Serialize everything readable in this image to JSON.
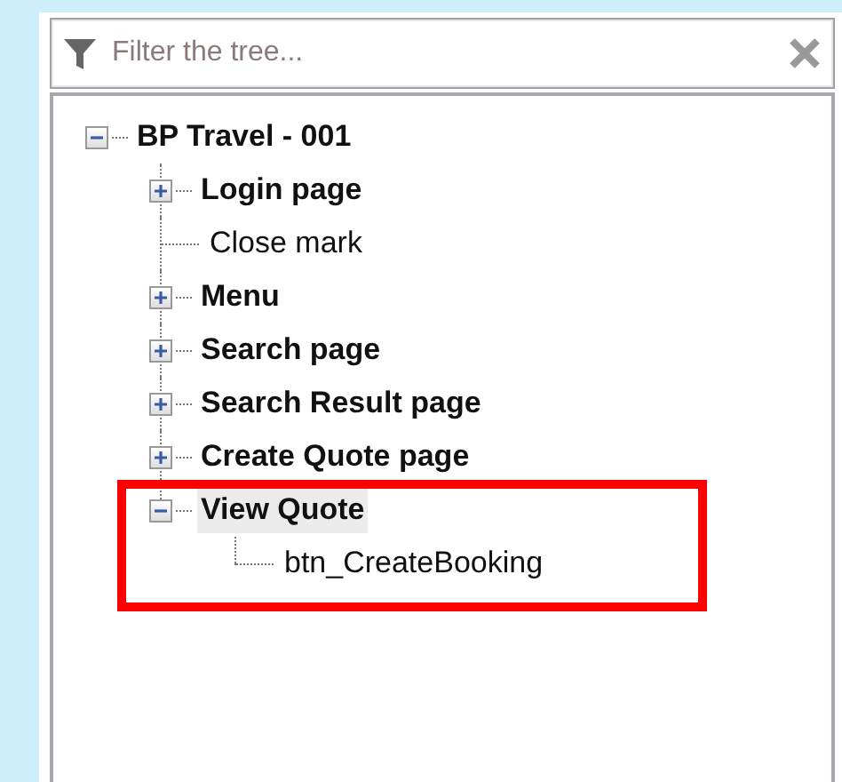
{
  "filter": {
    "placeholder": "Filter the tree..."
  },
  "tree": [
    {
      "label": "BP Travel - 001",
      "expanded": true,
      "selected": false,
      "highlighted": false,
      "children": [
        {
          "label": "Login page",
          "expanded": false,
          "selected": false,
          "highlighted": false
        },
        {
          "label": "Close mark",
          "selected": false,
          "highlighted": false
        },
        {
          "label": "Menu",
          "expanded": false,
          "selected": false,
          "highlighted": false
        },
        {
          "label": "Search page",
          "expanded": false,
          "selected": false,
          "highlighted": false
        },
        {
          "label": "Search Result page",
          "expanded": false,
          "selected": false,
          "highlighted": false
        },
        {
          "label": "Create Quote page",
          "expanded": false,
          "selected": false,
          "highlighted": false
        },
        {
          "label": "View Quote",
          "expanded": true,
          "selected": true,
          "highlighted": true,
          "children": [
            {
              "label": "btn_CreateBooking",
              "selected": false,
              "highlighted": false
            }
          ]
        }
      ]
    }
  ]
}
